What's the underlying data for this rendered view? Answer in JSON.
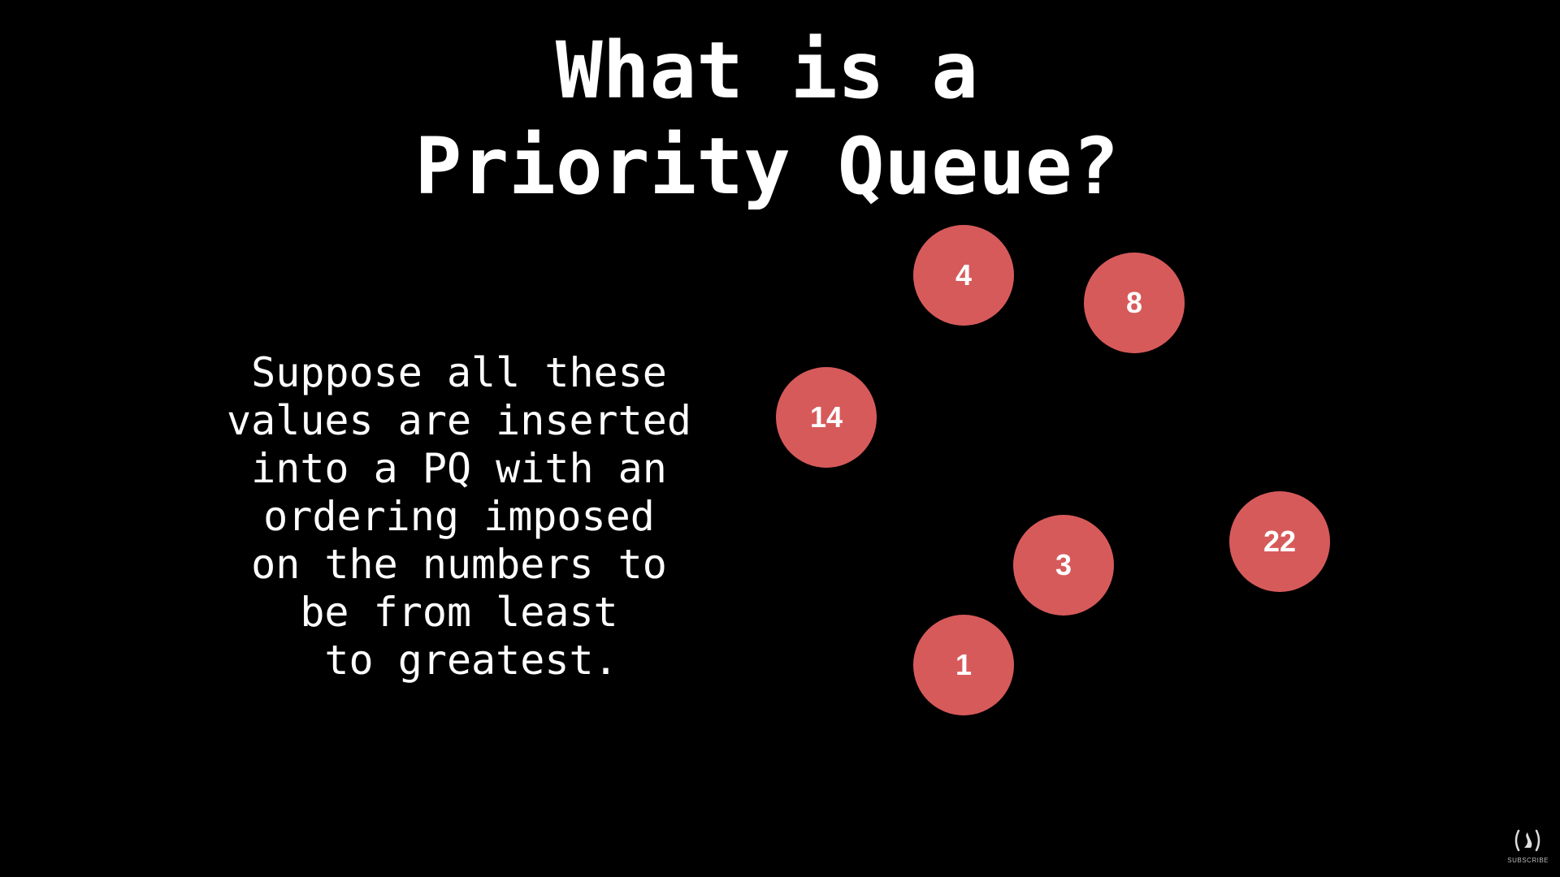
{
  "title": {
    "line1": "What is a",
    "line2": "Priority Queue?"
  },
  "description": {
    "lines": [
      "Suppose all these",
      "values are inserted",
      "into a PQ with an",
      "ordering imposed",
      "on the numbers to",
      "be from least",
      " to greatest."
    ]
  },
  "nodes": {
    "node_4": "4",
    "node_8": "8",
    "node_14": "14",
    "node_22": "22",
    "node_3": "3",
    "node_1": "1"
  },
  "colors": {
    "background": "#000000",
    "node_fill": "#d75a5b",
    "text": "#ffffff"
  },
  "brand": {
    "logo_icon": "freecodecamp-logo-icon",
    "caption": "SUBSCRIBE"
  }
}
